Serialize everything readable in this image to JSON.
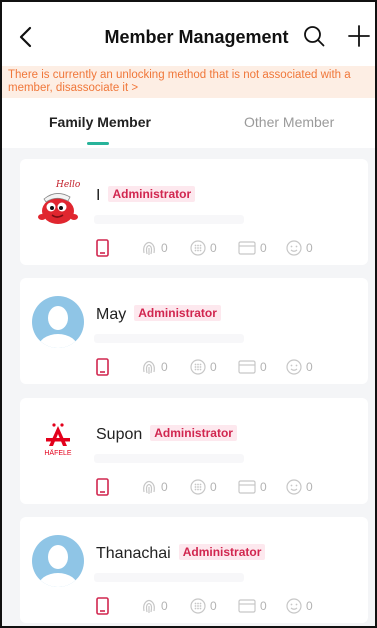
{
  "header": {
    "title": "Member Management",
    "back_icon": "chevron-left-icon",
    "search_icon": "search-icon",
    "add_icon": "plus-icon"
  },
  "notice": {
    "text": "There is currently an unlocking method that is not associated with a member, disassociate it >"
  },
  "tabs": [
    {
      "label": "Family Member",
      "active": true
    },
    {
      "label": "Other Member",
      "active": false
    }
  ],
  "colors": {
    "accent": "#27b39a",
    "notice_text": "#f0773a",
    "notice_bg": "#fdeee4",
    "badge_text": "#d1264f",
    "badge_bg": "#fde8ee",
    "phone_icon": "#d1264f"
  },
  "members": [
    {
      "name": "I",
      "role": "Administrator",
      "avatar": "hello-mascot-avatar",
      "counts": {
        "fingerprint": "0",
        "password": "0",
        "card": "0",
        "face": "0"
      }
    },
    {
      "name": "May",
      "role": "Administrator",
      "avatar": "default-person-avatar",
      "counts": {
        "fingerprint": "0",
        "password": "0",
        "card": "0",
        "face": "0"
      }
    },
    {
      "name": "Supon",
      "role": "Administrator",
      "avatar": "hafele-logo-avatar",
      "avatar_text": "HÄFELE",
      "counts": {
        "fingerprint": "0",
        "password": "0",
        "card": "0",
        "face": "0"
      }
    },
    {
      "name": "Thanachai",
      "role": "Administrator",
      "avatar": "default-person-avatar",
      "counts": {
        "fingerprint": "0",
        "password": "0",
        "card": "0",
        "face": "0"
      }
    }
  ]
}
